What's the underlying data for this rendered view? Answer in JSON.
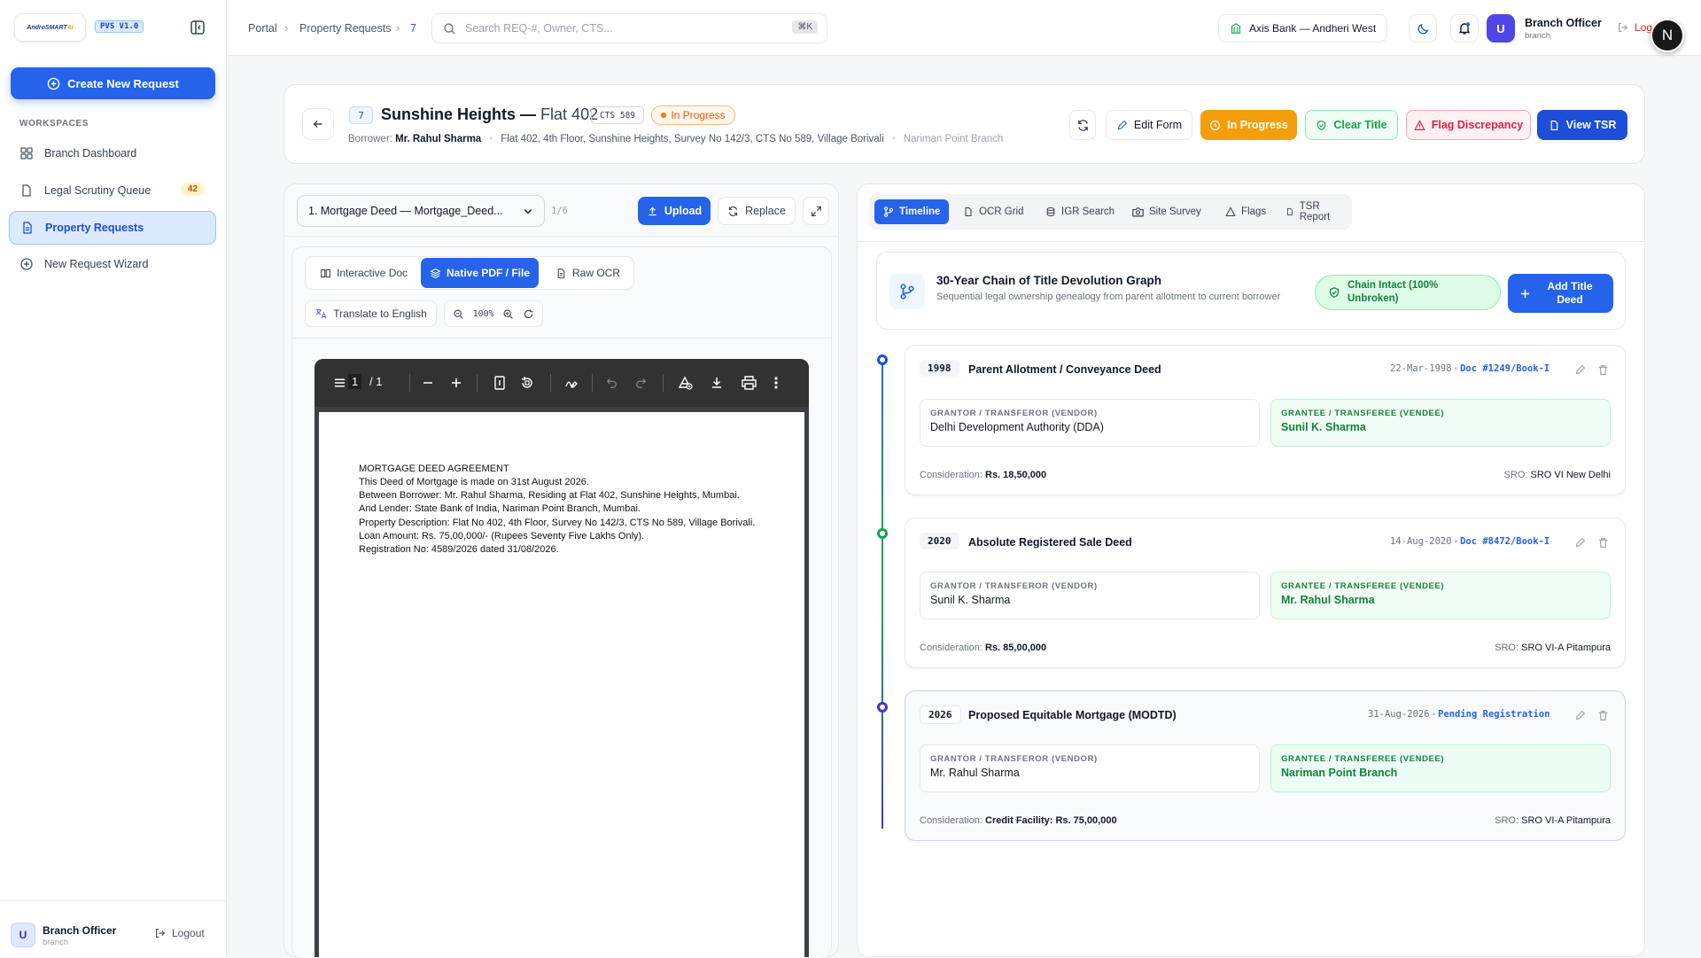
{
  "sidebar": {
    "logo_text": "AndroSmartAi",
    "logo_main": "AndroSMART",
    "logo_ai": "Ai",
    "version": "PVS V1.0",
    "create_button": "Create New Request",
    "workspaces_label": "WORKSPACES",
    "items": [
      {
        "label": "Branch Dashboard",
        "icon": "dashboard-grid-icon"
      },
      {
        "label": "Legal Scrutiny Queue",
        "icon": "document-icon",
        "badge": "42"
      },
      {
        "label": "Property Requests",
        "icon": "file-list-icon",
        "active": true
      },
      {
        "label": "New Request Wizard",
        "icon": "plus-circle-icon"
      }
    ],
    "footer": {
      "avatar": "U",
      "name": "Branch Officer",
      "role": "branch",
      "logout": "Logout"
    }
  },
  "topbar": {
    "breadcrumb": [
      "Portal",
      "Property Requests",
      "7"
    ],
    "search_placeholder": "Search REQ-#, Owner, CTS...",
    "search_shortcut": "⌘K",
    "branch": "Axis Bank — Andheri West",
    "user": {
      "avatar": "U",
      "name": "Branch Officer",
      "role": "branch"
    },
    "logout": "Log",
    "floating_avatar": "N"
  },
  "header": {
    "req_id": "7",
    "title_main": "Sunshine Heights —",
    "title_sub": "Flat 402",
    "cts": "CTS 589",
    "status": "In Progress",
    "borrower_label": "Borrower:",
    "borrower_name": "Mr. Rahul Sharma",
    "address": "Flat 402, 4th Floor, Sunshine Heights, Survey No 142/3, CTS No 589, Village Borivali",
    "branch": "Nariman Point Branch",
    "actions": {
      "edit": "Edit Form",
      "progress": "In Progress",
      "clear": "Clear Title",
      "flag": "Flag Discrepancy",
      "tsr": "View TSR"
    }
  },
  "doc_panel": {
    "selected_doc": "1. Mortgage Deed — Mortgage_Deed...",
    "doc_count": "1/6",
    "upload": "Upload",
    "replace": "Replace",
    "view_modes": [
      "Interactive Doc",
      "Native PDF / File",
      "Raw OCR"
    ],
    "active_mode": "Native PDF / File",
    "translate": "Translate to English",
    "zoom": "100%",
    "pdf": {
      "page": "1",
      "total": "/ 1",
      "lines": [
        "MORTGAGE DEED AGREEMENT",
        "This Deed of Mortgage is made on 31st August 2026.",
        "Between Borrower: Mr. Rahul Sharma, Residing at Flat 402, Sunshine Heights, Mumbai.",
        "And Lender: State Bank of India, Nariman Point Branch, Mumbai.",
        "Property Description: Flat No 402, 4th Floor, Survey No 142/3, CTS No 589, Village Borivali.",
        "Loan Amount: Rs. 75,00,000/- (Rupees Seventy Five Lakhs Only).",
        "Registration No: 4589/2026 dated 31/08/2026."
      ]
    }
  },
  "right_panel": {
    "tabs": [
      "Timeline",
      "OCR Grid",
      "IGR Search",
      "Site Survey",
      "Flags",
      "TSR Report"
    ],
    "active_tab": "Timeline",
    "graph_title": "30-Year Chain of Title Devolution Graph",
    "graph_subtitle": "Sequential legal ownership genealogy from parent allotment to current borrower",
    "chain_status": "Chain Intact (100% Unbroken)",
    "add_deed": "Add Title Deed",
    "vendor_label": "GRANTOR / TRANSFEROR (VENDOR)",
    "vendee_label": "GRANTEE / TRANSFEREE (VENDEE)",
    "consideration_label": "Consideration:",
    "sro_label": "SRO:",
    "entries": [
      {
        "year": "1998",
        "title": "Parent Allotment / Conveyance Deed",
        "date": "22-Mar-1998",
        "doc": "Doc #1249/Book-I",
        "vendor": "Delhi Development Authority (DDA)",
        "vendee": "Sunil K. Sharma",
        "consideration": "Rs. 18,50,000",
        "sro": "SRO VI New Delhi",
        "node_color": "#1d4ed8"
      },
      {
        "year": "2020",
        "title": "Absolute Registered Sale Deed",
        "date": "14-Aug-2020",
        "doc": "Doc #8472/Book-I",
        "vendor": "Sunil K. Sharma",
        "vendee": "Mr. Rahul Sharma",
        "consideration": "Rs. 85,00,000",
        "sro": "SRO VI-A Pitampura",
        "node_color": "#16a34a"
      },
      {
        "year": "2026",
        "title": "Proposed Equitable Mortgage (MODTD)",
        "date": "31-Aug-2026",
        "doc": "Pending Registration",
        "vendor": "Mr. Rahul Sharma",
        "vendee": "Nariman Point Branch",
        "consideration": "Credit Facility: Rs. 75,00,000",
        "sro": "SRO VI-A Pitampura",
        "node_color": "#4338ca"
      }
    ]
  }
}
